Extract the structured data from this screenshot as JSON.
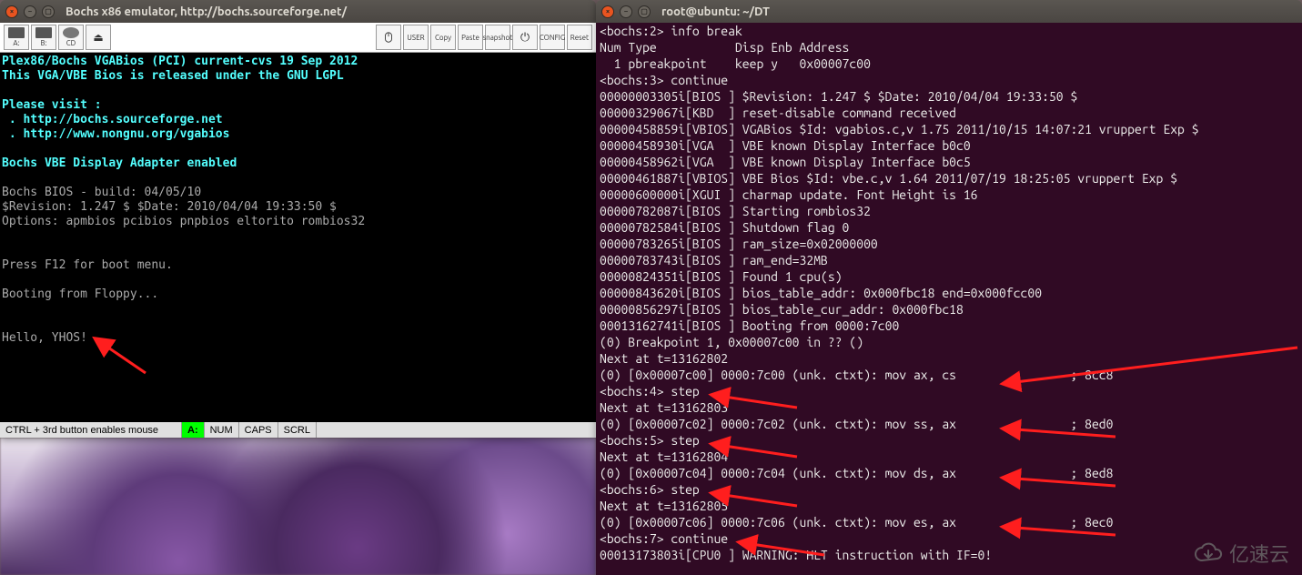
{
  "bochs_window": {
    "title": "Bochs x86 emulator, http://bochs.sourceforge.net/",
    "toolbar": {
      "drives": [
        "A:",
        "B:",
        "CD",
        "⏏"
      ],
      "right_buttons": [
        "USER",
        "Copy",
        "Paste",
        "snapshot",
        "⚙",
        "CONFIG",
        "Reset"
      ]
    },
    "vga_lines": [
      {
        "cls": "cyan",
        "text": "Plex86/Bochs VGABios (PCI) current-cvs 19 Sep 2012"
      },
      {
        "cls": "cyan",
        "text": "This VGA/VBE Bios is released under the GNU LGPL"
      },
      {
        "cls": "",
        "text": ""
      },
      {
        "cls": "cyan",
        "text": "Please visit :"
      },
      {
        "cls": "cyan",
        "text": " . http://bochs.sourceforge.net"
      },
      {
        "cls": "cyan",
        "text": " . http://www.nongnu.org/vgabios"
      },
      {
        "cls": "",
        "text": ""
      },
      {
        "cls": "cyan",
        "text": "Bochs VBE Display Adapter enabled"
      },
      {
        "cls": "",
        "text": ""
      },
      {
        "cls": "gray",
        "text": "Bochs BIOS - build: 04/05/10"
      },
      {
        "cls": "gray",
        "text": "$Revision: 1.247 $ $Date: 2010/04/04 19:33:50 $"
      },
      {
        "cls": "gray",
        "text": "Options: apmbios pcibios pnpbios eltorito rombios32"
      },
      {
        "cls": "",
        "text": ""
      },
      {
        "cls": "",
        "text": ""
      },
      {
        "cls": "gray",
        "text": "Press F12 for boot menu."
      },
      {
        "cls": "",
        "text": ""
      },
      {
        "cls": "gray",
        "text": "Booting from Floppy..."
      },
      {
        "cls": "",
        "text": ""
      },
      {
        "cls": "",
        "text": ""
      },
      {
        "cls": "gray",
        "text": "Hello, YHOS!"
      }
    ],
    "status": {
      "mouse_hint": "CTRL + 3rd button enables mouse",
      "drive": "A:",
      "indicators": [
        "NUM",
        "CAPS",
        "SCRL"
      ]
    }
  },
  "terminal_window": {
    "title": "root@ubuntu: ~/DT",
    "lines": [
      "<bochs:2> info break",
      "Num Type           Disp Enb Address",
      "  1 pbreakpoint    keep y   0x00007c00",
      "<bochs:3> continue",
      "00000003305i[BIOS ] $Revision: 1.247 $ $Date: 2010/04/04 19:33:50 $",
      "00000329067i[KBD  ] reset-disable command received",
      "00000458859i[VBIOS] VGABios $Id: vgabios.c,v 1.75 2011/10/15 14:07:21 vruppert Exp $",
      "00000458930i[VGA  ] VBE known Display Interface b0c0",
      "00000458962i[VGA  ] VBE known Display Interface b0c5",
      "00000461887i[VBIOS] VBE Bios $Id: vbe.c,v 1.64 2011/07/19 18:25:05 vruppert Exp $",
      "00000600000i[XGUI ] charmap update. Font Height is 16",
      "00000782087i[BIOS ] Starting rombios32",
      "00000782584i[BIOS ] Shutdown flag 0",
      "00000783265i[BIOS ] ram_size=0x02000000",
      "00000783743i[BIOS ] ram_end=32MB",
      "00000824351i[BIOS ] Found 1 cpu(s)",
      "00000843620i[BIOS ] bios_table_addr: 0x000fbc18 end=0x000fcc00",
      "00000856297i[BIOS ] bios_table_cur_addr: 0x000fbc18",
      "00013162741i[BIOS ] Booting from 0000:7c00",
      "(0) Breakpoint 1, 0x00007c00 in ?? ()",
      "Next at t=13162802",
      "(0) [0x00007c00] 0000:7c00 (unk. ctxt): mov ax, cs                ; 8cc8",
      "<bochs:4> step",
      "Next at t=13162803",
      "(0) [0x00007c02] 0000:7c02 (unk. ctxt): mov ss, ax                ; 8ed0",
      "<bochs:5> step",
      "Next at t=13162804",
      "(0) [0x00007c04] 0000:7c04 (unk. ctxt): mov ds, ax                ; 8ed8",
      "<bochs:6> step",
      "Next at t=13162805",
      "(0) [0x00007c06] 0000:7c06 (unk. ctxt): mov es, ax                ; 8ec0",
      "<bochs:7> continue",
      "00013173803i[CPU0 ] WARNING: HLT instruction with IF=0!"
    ]
  },
  "watermark": {
    "text": "亿速云"
  }
}
